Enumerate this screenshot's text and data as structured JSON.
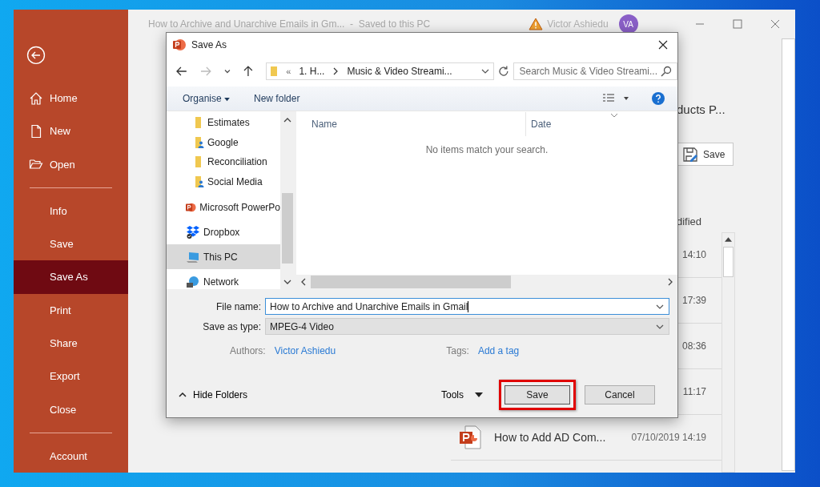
{
  "window": {
    "title": "How to Archive and Unarchive Emails in Gm...  -  Saved to this PC",
    "user": "Victor Ashiedu",
    "avatar_initials": "VA"
  },
  "backstage": {
    "groups": [
      {
        "items": [
          {
            "label": "Home",
            "selected": false
          },
          {
            "label": "New",
            "selected": false
          },
          {
            "label": "Open",
            "selected": false
          }
        ]
      },
      {
        "items": [
          {
            "label": "Info",
            "selected": false
          },
          {
            "label": "Save",
            "selected": false
          },
          {
            "label": "Save As",
            "selected": true
          },
          {
            "label": "Print",
            "selected": false
          },
          {
            "label": "Share",
            "selected": false
          },
          {
            "label": "Export",
            "selected": false
          },
          {
            "label": "Close",
            "selected": false
          }
        ]
      },
      {
        "items": [
          {
            "label": "Account",
            "selected": false
          }
        ]
      }
    ]
  },
  "background_panel": {
    "heading_fragment": "ducts P...",
    "save_button": "Save",
    "column_fragment": "dified",
    "times": [
      "14:10",
      "17:39",
      "08:36",
      "11:17"
    ],
    "recent_file": {
      "name": "How to Add AD Com...",
      "modified": "07/10/2019 14:19"
    }
  },
  "dialog": {
    "title": "Save As",
    "address": {
      "overflow": "«",
      "segments": [
        "1. H...",
        "Music & Video Streami..."
      ]
    },
    "search": {
      "placeholder": "Search Music & Video Streami..."
    },
    "toolbar": {
      "organise": "Organise",
      "new_folder": "New folder"
    },
    "nav_pane": {
      "items": [
        {
          "label": "Estimates",
          "kind": "folder",
          "selected": false
        },
        {
          "label": "Google",
          "kind": "shared-folder",
          "selected": false
        },
        {
          "label": "Reconciliation",
          "kind": "folder",
          "selected": false
        },
        {
          "label": "Social Media",
          "kind": "shared-folder",
          "selected": false
        },
        {
          "label": "Microsoft PowerPo",
          "kind": "app",
          "selected": false
        },
        {
          "label": "Dropbox",
          "kind": "cloud",
          "selected": false
        },
        {
          "label": "This PC",
          "kind": "computer",
          "selected": true
        },
        {
          "label": "Network",
          "kind": "network",
          "selected": false
        }
      ]
    },
    "columns": [
      "Name",
      "Date"
    ],
    "empty_message": "No items match your search.",
    "file_name": {
      "label": "File name:",
      "value": "How to Archive and Unarchive Emails in Gmail"
    },
    "save_as_type": {
      "label": "Save as type:",
      "value": "MPEG-4 Video"
    },
    "authors": {
      "label": "Authors:",
      "value": "Victor Ashiedu"
    },
    "tags": {
      "label": "Tags:",
      "value": "Add a tag"
    },
    "hide_folders": "Hide Folders",
    "tools": "Tools",
    "buttons": [
      {
        "label": "Save",
        "kind": "primary",
        "highlighted": true
      },
      {
        "label": "Cancel",
        "kind": "secondary",
        "highlighted": false
      }
    ]
  }
}
